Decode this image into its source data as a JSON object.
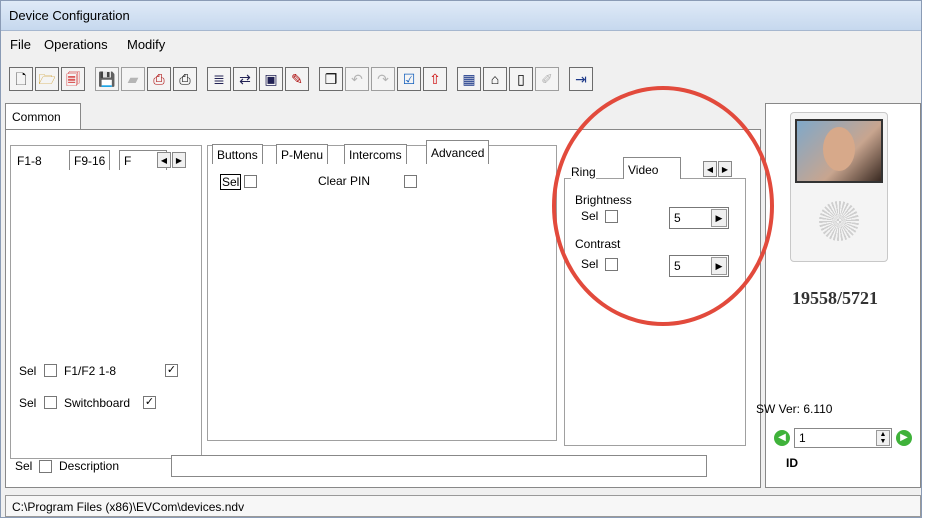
{
  "window": {
    "title": "Device Configuration"
  },
  "menu": {
    "file": "File",
    "operations": "Operations",
    "modify": "Modify"
  },
  "toolbar": {
    "icons": [
      "new-file-icon",
      "open-folder-icon",
      "open-red-icon",
      "save-icon",
      "save-all-icon",
      "print-preview-icon",
      "print-icon",
      "import-icon",
      "export-icon",
      "window-icon",
      "edit-icon",
      "copy-icon",
      "undo-icon",
      "redo-icon",
      "check-icon",
      "upload-icon",
      "keyboard-icon",
      "network-icon",
      "device-icon",
      "tools-icon",
      "exit-icon"
    ]
  },
  "common_tab": {
    "label": "Common"
  },
  "left_panel": {
    "tabs": [
      "F1-8",
      "F9-16",
      "F"
    ],
    "rows": [
      {
        "sel": "Sel",
        "label": "F1/F2 1-8",
        "checked": "✓"
      },
      {
        "sel": "Sel",
        "label": "Switchboard",
        "checked": "✓"
      }
    ]
  },
  "middle_panel": {
    "tabs": [
      "Buttons",
      "P-Menu",
      "Intercoms",
      "Advanced"
    ],
    "sel_label": "Sel",
    "clear_pin_label": "Clear PIN"
  },
  "video_panel": {
    "tabs": [
      "Ring",
      "Video"
    ],
    "brightness": {
      "label": "Brightness",
      "sel": "Sel",
      "value": "5"
    },
    "contrast": {
      "label": "Contrast",
      "sel": "Sel",
      "value": "5"
    }
  },
  "description": {
    "sel": "Sel",
    "label": "Description",
    "value": ""
  },
  "device": {
    "code": "19558/5721",
    "sw_version": "SW Ver: 6.110",
    "id_value": "1",
    "id_label": "ID"
  },
  "status_bar": {
    "path": "C:\\Program Files (x86)\\EVCom\\devices.ndv"
  },
  "colors": {
    "annotation_circle": "#e24a3c",
    "titlebar": "#c6d8ee"
  }
}
